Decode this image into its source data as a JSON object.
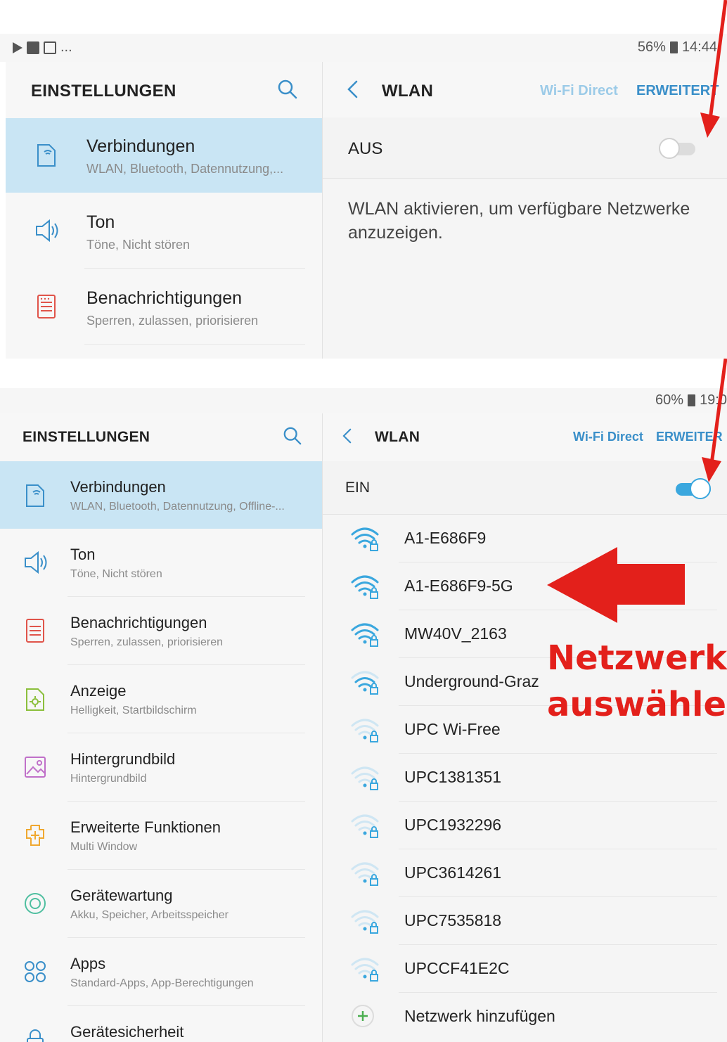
{
  "screen1": {
    "status": {
      "left_more": "...",
      "battery": "56%",
      "time": "14:44"
    },
    "left_header": {
      "title": "EINSTELLUNGEN"
    },
    "right_header": {
      "title": "WLAN",
      "wifi_direct": "Wi-Fi Direct",
      "advanced": "ERWEITERT"
    },
    "toggle": {
      "label": "AUS",
      "on": false
    },
    "message": "WLAN aktivieren, um verfügbare Netzwerke anzuzeigen.",
    "items": [
      {
        "title": "Verbindungen",
        "subtitle": "WLAN, Bluetooth, Datennutzung,...",
        "icon": "connections-icon",
        "active": true
      },
      {
        "title": "Ton",
        "subtitle": "Töne, Nicht stören",
        "icon": "speaker-icon",
        "active": false
      },
      {
        "title": "Benachrichtigungen",
        "subtitle": "Sperren, zulassen, priorisieren",
        "icon": "notifications-icon",
        "active": false
      }
    ]
  },
  "screen2": {
    "status": {
      "battery": "60%",
      "time": "19:0"
    },
    "left_header": {
      "title": "EINSTELLUNGEN"
    },
    "right_header": {
      "title": "WLAN",
      "wifi_direct": "Wi-Fi Direct",
      "advanced": "ERWEITER"
    },
    "toggle": {
      "label": "EIN",
      "on": true
    },
    "items": [
      {
        "title": "Verbindungen",
        "subtitle": "WLAN, Bluetooth, Datennutzung, Offline-...",
        "icon": "connections-icon",
        "active": true
      },
      {
        "title": "Ton",
        "subtitle": "Töne, Nicht stören",
        "icon": "speaker-icon",
        "active": false
      },
      {
        "title": "Benachrichtigungen",
        "subtitle": "Sperren, zulassen, priorisieren",
        "icon": "notifications-icon",
        "active": false
      },
      {
        "title": "Anzeige",
        "subtitle": "Helligkeit, Startbildschirm",
        "icon": "display-icon",
        "active": false
      },
      {
        "title": "Hintergrundbild",
        "subtitle": "Hintergrundbild",
        "icon": "wallpaper-icon",
        "active": false
      },
      {
        "title": "Erweiterte Funktionen",
        "subtitle": "Multi Window",
        "icon": "advanced-features-icon",
        "active": false
      },
      {
        "title": "Gerätewartung",
        "subtitle": "Akku, Speicher, Arbeitsspeicher",
        "icon": "device-maintenance-icon",
        "active": false
      },
      {
        "title": "Apps",
        "subtitle": "Standard-Apps, App-Berechtigungen",
        "icon": "apps-icon",
        "active": false
      },
      {
        "title": "Gerätesicherheit",
        "subtitle": "",
        "icon": "lock-icon",
        "active": false
      }
    ],
    "networks": [
      {
        "name": "A1-E686F9",
        "signal": 4
      },
      {
        "name": "A1-E686F9-5G",
        "signal": 4
      },
      {
        "name": "MW40V_2163",
        "signal": 4
      },
      {
        "name": "Underground-Graz",
        "signal": 3
      },
      {
        "name": "UPC Wi-Free",
        "signal": 1
      },
      {
        "name": "UPC1381351",
        "signal": 1
      },
      {
        "name": "UPC1932296",
        "signal": 1
      },
      {
        "name": "UPC3614261",
        "signal": 1
      },
      {
        "name": "UPC7535818",
        "signal": 1
      },
      {
        "name": "UPCCF41E2C",
        "signal": 1
      }
    ],
    "add_network": "Netzwerk hinzufügen"
  },
  "annotation": {
    "line1": "Netzwerk",
    "line2": "auswählen"
  },
  "colors": {
    "accent": "#3aa7de",
    "active_bg": "#c9e5f4",
    "link": "#3a8fc9",
    "link_faint": "#9ccbe8",
    "annotation": "#e3201b"
  }
}
